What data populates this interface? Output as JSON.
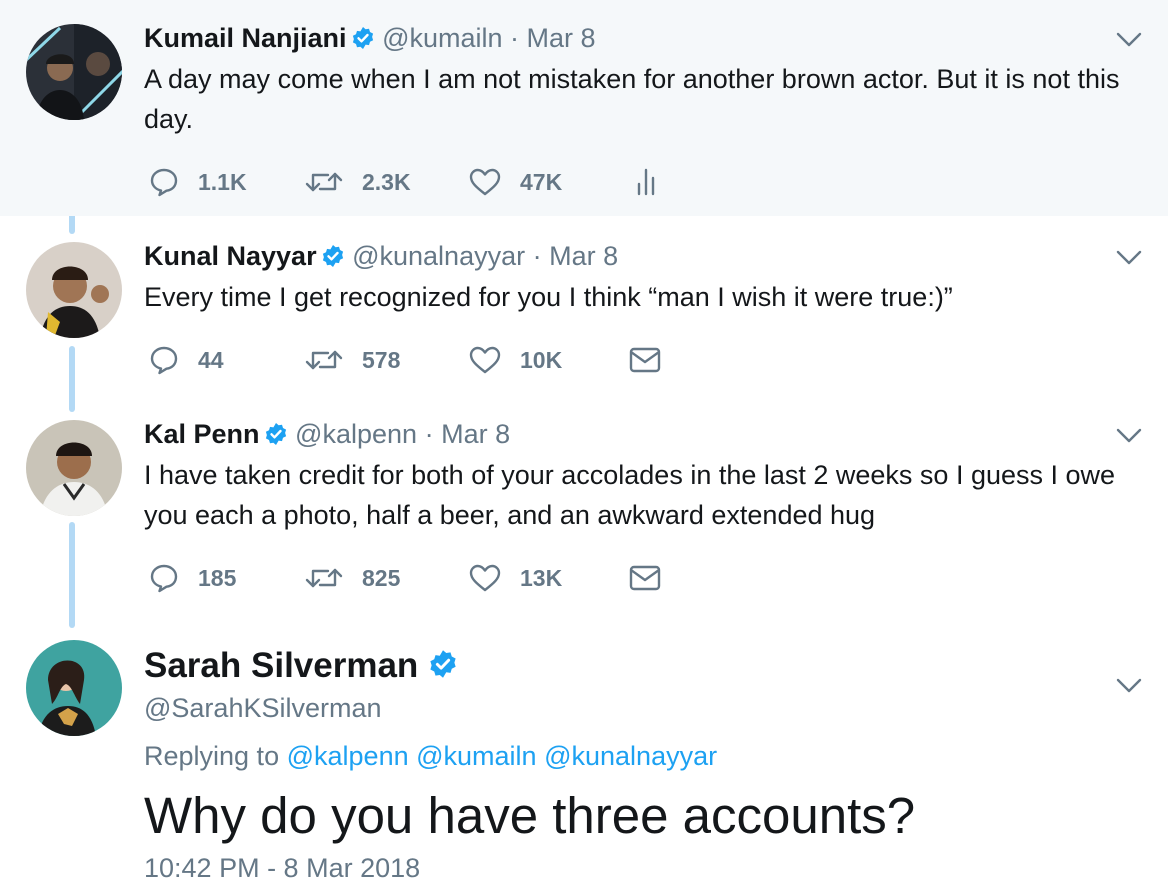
{
  "colors": {
    "accent": "#1da1f2",
    "muted": "#657786",
    "text": "#14171a",
    "thread_line": "#b3d9f5",
    "highlight_bg": "#f5f8fa"
  },
  "tweets": [
    {
      "name": "Kumail Nanjiani",
      "handle": "@kumailn",
      "separator": "·",
      "date": "Mar 8",
      "text": "A day may come when I am not mistaken for another brown actor. But it is not this day.",
      "replies": "1.1K",
      "retweets": "2.3K",
      "likes": "47K",
      "extra_action_icon": "analytics-icon"
    },
    {
      "name": "Kunal Nayyar",
      "handle": "@kunalnayyar",
      "separator": "·",
      "date": "Mar 8",
      "text": "Every time I get recognized for you I think “man I wish it were true:)”",
      "replies": "44",
      "retweets": "578",
      "likes": "10K",
      "extra_action_icon": "direct-message-icon"
    },
    {
      "name": "Kal Penn",
      "handle": "@kalpenn",
      "separator": "·",
      "date": "Mar 8",
      "text": "I have taken credit for both of your accolades in the last 2 weeks so I guess I owe you each a photo, half a beer, and an awkward extended hug",
      "replies": "185",
      "retweets": "825",
      "likes": "13K",
      "extra_action_icon": "direct-message-icon"
    }
  ],
  "main_tweet": {
    "name": "Sarah Silverman",
    "handle": "@SarahKSilverman",
    "replying_to_label": "Replying to",
    "mentions": [
      "@kalpenn",
      "@kumailn",
      "@kunalnayyar"
    ],
    "text": "Why do you have three accounts?",
    "timestamp": "10:42 PM - 8 Mar 2018"
  }
}
